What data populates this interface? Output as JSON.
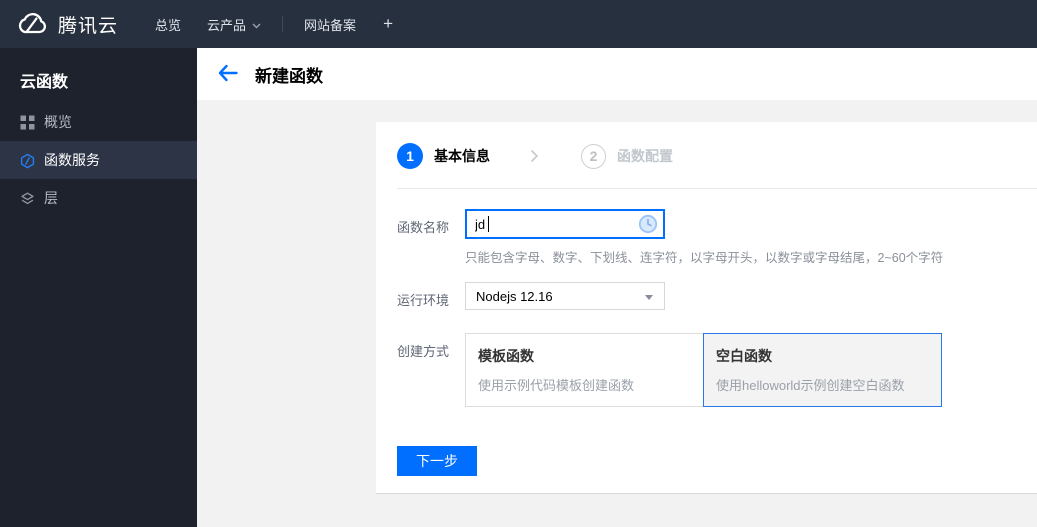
{
  "topnav": {
    "brand": "腾讯云",
    "items": {
      "overview": "总览",
      "products": "云产品",
      "icp": "网站备案",
      "add": "+"
    }
  },
  "sidebar": {
    "title": "云函数",
    "items": [
      {
        "label": "概览",
        "icon": "grid-icon",
        "selected": false
      },
      {
        "label": "函数服务",
        "icon": "function-hexagon-icon",
        "selected": true
      },
      {
        "label": "层",
        "icon": "layers-icon",
        "selected": false
      }
    ]
  },
  "header": {
    "title": "新建函数",
    "back_icon": "arrow-left-icon"
  },
  "wizard": {
    "steps": [
      {
        "number": "1",
        "label": "基本信息",
        "active": true
      },
      {
        "number": "2",
        "label": "函数配置",
        "active": false
      }
    ]
  },
  "form": {
    "name_label": "函数名称",
    "name_value": "jd",
    "name_hint": "只能包含字母、数字、下划线、连字符，以字母开头，以数字或字母结尾，2~60个字符",
    "runtime_label": "运行环境",
    "runtime_value": "Nodejs 12.16",
    "method_label": "创建方式",
    "method_options": [
      {
        "title": "模板函数",
        "desc": "使用示例代码模板创建函数",
        "selected": false
      },
      {
        "title": "空白函数",
        "desc": "使用helloworld示例创建空白函数",
        "selected": true
      }
    ]
  },
  "actions": {
    "next": "下一步"
  },
  "colors": {
    "accent": "#006eff",
    "topnav_bg": "#27303e",
    "sidebar_bg": "#1e222d",
    "sidebar_selected_bg": "#2d3445",
    "content_bg": "#f2f2f2",
    "selected_card_border": "#2678e8"
  }
}
